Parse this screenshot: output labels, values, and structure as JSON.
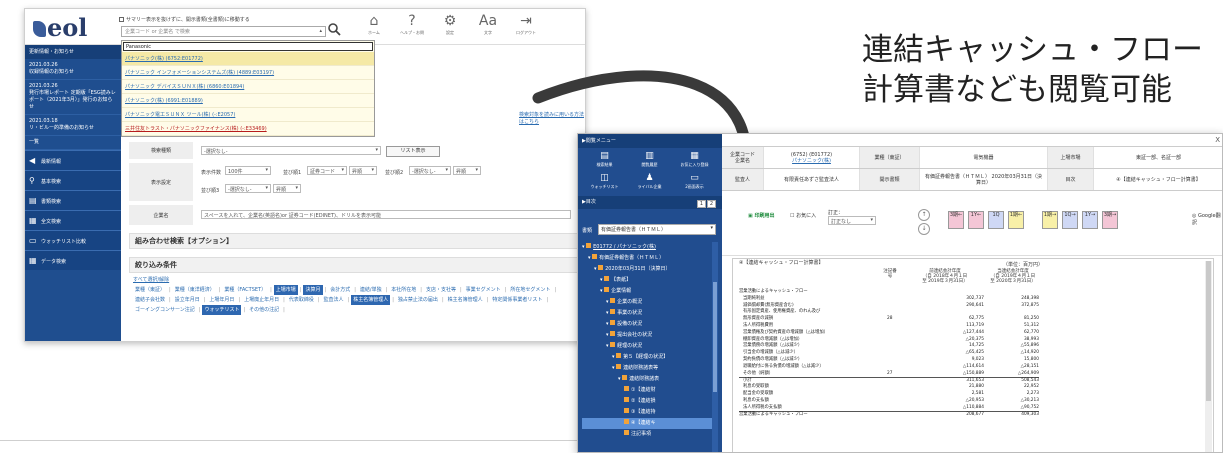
{
  "left_window": {
    "logo_text": "eol",
    "search_hint": "サマリー表示を抜けずに、開示書類(全書類)に移動する",
    "company_search_placeholder": "企業コード or 企業名 で検索",
    "top_nav": [
      {
        "icon": "home-icon",
        "glyph": "⌂",
        "label": "ホーム"
      },
      {
        "icon": "help-icon",
        "glyph": "?",
        "label": "ヘルプ・お問"
      },
      {
        "icon": "gear-icon",
        "glyph": "⚙",
        "label": "設定"
      },
      {
        "icon": "font-size-icon",
        "glyph": "Aa",
        "label": "文字"
      },
      {
        "icon": "logout-icon",
        "glyph": "⇥",
        "label": "ログアウト"
      }
    ],
    "dropdown": {
      "input_value": "Panasonic",
      "options": [
        "パナソニック(株) (6752:E01772)",
        "パナソニック インフォメーションシステムズ(株) (4889:E03197)",
        "パナソニック デバイスＳＵＮＸ(株) (6860:E01894)",
        "パナソニック(株) (6991:E01889)",
        "パナソニック電工ＳＵＮＸ ツール(株) (-:E2057)",
        "三井住友トラスト・パナソニックファイナンス(株) (-:E33469)"
      ]
    },
    "sidebar": {
      "news_header": "更新情報・お知らせ",
      "news": [
        {
          "date": "2021.03.26",
          "text": "収録情報のお知らせ"
        },
        {
          "date": "2021.03.26",
          "text": "発行市場レポート 定期版「ESG読みレポート（2021年3月）」発行のお知らせ"
        },
        {
          "date": "2021.03.18",
          "text": "リ・ビルー的準備のお知らせ"
        }
      ],
      "more": "一覧",
      "nav": [
        {
          "icon": "megaphone-icon",
          "glyph": "◀",
          "label": "最新情報"
        },
        {
          "icon": "search-icon",
          "glyph": "⚲",
          "label": "基本検索"
        },
        {
          "icon": "document-search-icon",
          "glyph": "▤",
          "label": "書類検索"
        },
        {
          "icon": "fulltext-search-icon",
          "glyph": "▦",
          "label": "全文検索"
        },
        {
          "icon": "watchlist-icon",
          "glyph": "▭",
          "label": "ウォッチリスト比較"
        },
        {
          "icon": "data-icon",
          "glyph": "▦",
          "label": "データ検索"
        }
      ]
    },
    "form": {
      "right_link": "検索対象を読みに用いる方法はこちら",
      "doc_type_label": "検索種類",
      "doc_type_value": "-選択なし-",
      "list_button": "リスト表示",
      "display_label": "表示設定",
      "display_count_label": "表示件数",
      "display_count": "100件",
      "sort1_label": "並び順1",
      "sort1_value": "証券コード",
      "sort1_dir": "昇順",
      "sort2_label": "並び順2",
      "sort2_value": "-選択なし-",
      "sort2_dir": "昇順",
      "sort3_label": "並び順3",
      "sort3_value": "-選択なし-",
      "sort3_dir": "昇順",
      "company_label": "企業名",
      "company_placeholder": "スペースを入れて、企業名(英語名)or 証券コード(EDINET)、ドリルを表示可能"
    },
    "options_header": "組み合わせ検索【オプション】",
    "filters_header": "絞り込み条件",
    "filters": {
      "select_all": "すべて選択/解除",
      "line1": [
        {
          "label": "業種（東証）",
          "on": false
        },
        {
          "label": "業種（東洋経済）",
          "on": false
        },
        {
          "label": "業種（FACTSET）",
          "on": false
        },
        {
          "label": "上場市場",
          "on": true
        },
        {
          "label": "決算月",
          "on": true
        },
        {
          "label": "会計方式",
          "on": false
        },
        {
          "label": "連結/単独",
          "on": false
        },
        {
          "label": "本社所在地",
          "on": false
        },
        {
          "label": "支店・支社等",
          "on": false
        },
        {
          "label": "事業セグメント",
          "on": false
        },
        {
          "label": "所在地セグメント",
          "on": false
        }
      ],
      "line2": [
        {
          "label": "連結子会社数",
          "on": false
        },
        {
          "label": "設立年月日",
          "on": false
        },
        {
          "label": "上場年月日",
          "on": false
        },
        {
          "label": "上場廃止年月日",
          "on": false
        },
        {
          "label": "代表取締役",
          "on": false
        },
        {
          "label": "監査法人",
          "on": false
        },
        {
          "label": "株主名簿管理人",
          "on": true
        },
        {
          "label": "独占禁止法の届出",
          "on": false
        },
        {
          "label": "株主名簿管理人",
          "on": false
        },
        {
          "label": "特定関係事業者リスト",
          "on": false
        }
      ],
      "line3": [
        {
          "label": "ゴーイングコンサーン注記",
          "on": false
        },
        {
          "label": "ウォッチリスト",
          "on": true
        },
        {
          "label": "その他の注記",
          "on": false
        }
      ]
    }
  },
  "caption": {
    "line1": "連結キャッシュ・フロー",
    "line2": "計算書なども閲覧可能"
  },
  "right_window": {
    "menu_header": "閲覧メニュー",
    "menu_icons": [
      {
        "icon": "search-results-icon",
        "glyph": "▤",
        "label": "検索結果"
      },
      {
        "icon": "history-icon",
        "glyph": "▥",
        "label": "閲覧履歴"
      },
      {
        "icon": "favorite-icon",
        "glyph": "▦",
        "label": "お気に入り登録"
      },
      {
        "icon": "watchlist-icon",
        "glyph": "◫",
        "label": "ウォッチリスト"
      },
      {
        "icon": "rival-icon",
        "glyph": "♟",
        "label": "ライバル企業"
      },
      {
        "icon": "compare-icon",
        "glyph": "▭",
        "label": "2画面表示"
      }
    ],
    "toc_header": "目次",
    "toc_buttons": [
      "1",
      "2"
    ],
    "doc_label": "書類",
    "doc_value": "有価証券報告書（ＨＴＭＬ）",
    "tree": [
      {
        "label": "E01772 / パナソニック(株)",
        "level": 0,
        "link": true
      },
      {
        "label": "有価証券報告書（ＨＴＭＬ）",
        "level": 1
      },
      {
        "label": "2020年03月31日（決算日）",
        "level": 2
      },
      {
        "label": "【表紙】",
        "level": 3
      },
      {
        "label": "企業情報",
        "level": 3
      },
      {
        "label": "企業の概況",
        "level": 4
      },
      {
        "label": "事業の状況",
        "level": 4
      },
      {
        "label": "設備の状況",
        "level": 4
      },
      {
        "label": "提出会社の状況",
        "level": 4
      },
      {
        "label": "経理の状況",
        "level": 4
      },
      {
        "label": "第５【経理の状況】",
        "level": 5
      },
      {
        "label": "連結財務諸表等",
        "level": 5
      },
      {
        "label": "連結財務諸表",
        "level": 6
      },
      {
        "label": "①【連結財",
        "level": 7
      },
      {
        "label": "②【連結損",
        "level": 7
      },
      {
        "label": "③【連結持",
        "level": 7
      },
      {
        "label": "④【連結キ",
        "level": 7,
        "selected": true
      },
      {
        "label": "注記事項",
        "level": 7
      }
    ],
    "info": {
      "code_label": "企業コード\n企業名",
      "code_value": "(6752) (E01772)",
      "code_company": "パナソニック(株)",
      "industry_label": "業種（東証）",
      "industry_value": "電気機器",
      "market_label": "上場市場",
      "market_value": "東証一部、名証一部",
      "auditor_label": "監査人",
      "auditor_value": "有限責任あずさ監査法人",
      "doc_label": "開示書類",
      "doc_value": "有価証券報告書（ＨＴＭＬ） 2020年03月31日（決算日）",
      "toc_label": "目次",
      "toc_value": "④【連結キャッシュ・フロー計算書】"
    },
    "toolbar": {
      "print": "印刷用出",
      "favorite": "お気に入",
      "correction_label": "訂正：",
      "correction_value": "訂正なし",
      "nav_buttons": [
        "3期←",
        "1Y←",
        "1Q",
        "1期←",
        "1期→",
        "1Q→",
        "1Y→",
        "3期→"
      ],
      "google": "Google翻訳"
    },
    "sheet": {
      "title": "④【連結キャッシュ・フロー計算書】",
      "unit": "（単位：百万円）",
      "note_header": "注記番号",
      "prev_header": "前連結会計年度\n（自 2018年４月１日\n至 2019年３月31日）",
      "curr_header": "当連結会計年度\n（自 2019年４月１日\n至 2020年３月31日）",
      "rows": [
        {
          "label": "営業活動によるキャッシュ・フロー",
          "note": "",
          "prev": "",
          "curr": ""
        },
        {
          "label": "当期純利益",
          "note": "",
          "prev": "302,737",
          "curr": "248,398"
        },
        {
          "label": "減価償却費(無形資産含む)",
          "note": "",
          "prev": "290,641",
          "curr": "372,875"
        },
        {
          "label": "有形固定資産、使用権資産、のれん及び",
          "note": "",
          "prev": "",
          "curr": ""
        },
        {
          "label": "無形資産の減損",
          "note": "28",
          "prev": "62,775",
          "curr": "81,250"
        },
        {
          "label": "法人所得税費用",
          "note": "",
          "prev": "113,719",
          "curr": "51,312"
        },
        {
          "label": "営業債権及び契約資産の増減額（△は増加）",
          "note": "",
          "prev": "△127,444",
          "curr": "62,770"
        },
        {
          "label": "棚卸資産の増減額（△は増加）",
          "note": "",
          "prev": "△20,375",
          "curr": "38,993"
        },
        {
          "label": "営業債務の増減額（△は減少）",
          "note": "",
          "prev": "14,725",
          "curr": "△55,896"
        },
        {
          "label": "引当金の増減額（△は減少）",
          "note": "",
          "prev": "△65,425",
          "curr": "△14,920"
        },
        {
          "label": "契約負債の増減額（△は減少）",
          "note": "",
          "prev": "9,023",
          "curr": "15,800"
        },
        {
          "label": "退職給付に係る負債の増減額（△は減少）",
          "note": "",
          "prev": "△114,614",
          "curr": "△28,151"
        },
        {
          "label": "その他（純額）",
          "note": "27",
          "prev": "△150,889",
          "curr": "△264,909"
        },
        {
          "label": "小計",
          "note": "",
          "prev": "311,653",
          "curr": "508,543",
          "sep": true
        },
        {
          "label": "利息の受取額",
          "note": "",
          "prev": "21,880",
          "curr": "22,952"
        },
        {
          "label": "配当金の受取額",
          "note": "",
          "prev": "2,581",
          "curr": "2,273"
        },
        {
          "label": "利息の支払額",
          "note": "",
          "prev": "△20,953",
          "curr": "△30,213"
        },
        {
          "label": "法人所得税の支払額",
          "note": "",
          "prev": "△110,884",
          "curr": "△90,752"
        },
        {
          "label": "営業活動によるキャッシュ・フロー",
          "note": "",
          "prev": "208,677",
          "curr": "409,303",
          "sep": true
        }
      ]
    }
  }
}
